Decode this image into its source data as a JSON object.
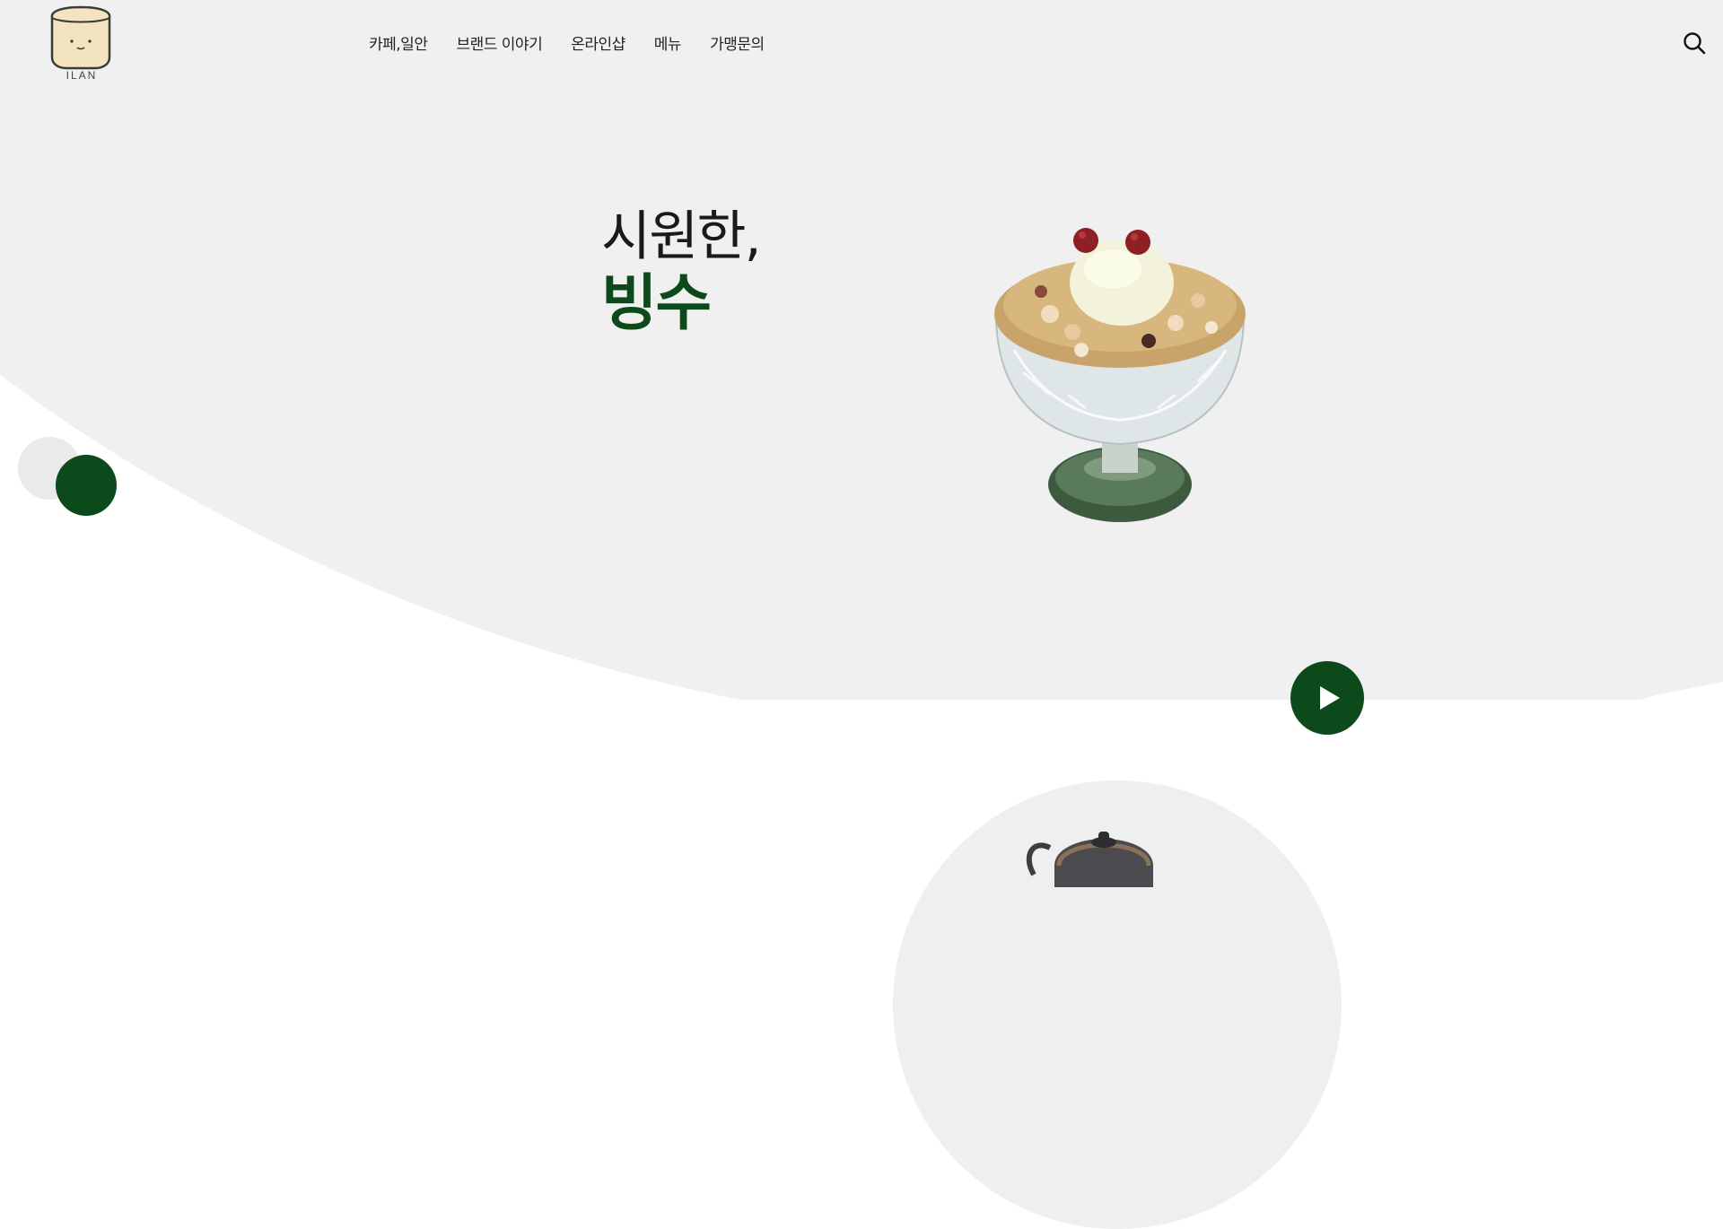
{
  "brand": {
    "logo_text": "ILAN"
  },
  "nav": {
    "items": [
      {
        "label": "카페,일안"
      },
      {
        "label": "브랜드 이야기"
      },
      {
        "label": "온라인샵"
      },
      {
        "label": "메뉴"
      },
      {
        "label": "가맹문의"
      }
    ]
  },
  "hero": {
    "line1": "시원한,",
    "line2": "빙수",
    "slide_count": 2,
    "active_slide": 2
  },
  "icons": {
    "search": "search-icon",
    "play": "play-icon",
    "logo": "cup-face-logo-icon"
  },
  "colors": {
    "accent": "#0c4a1c",
    "hero_background": "#f0f0f0",
    "page_background": "#ffffff"
  }
}
